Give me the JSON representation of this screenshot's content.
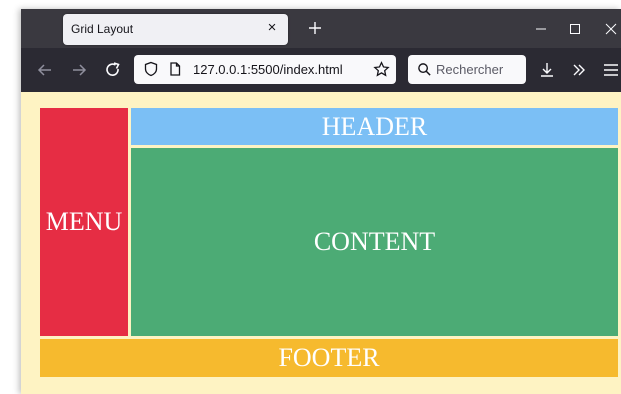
{
  "browser": {
    "tab": {
      "title": "Grid Layout",
      "close_glyph": "×"
    },
    "new_tab_icon": "plus-icon",
    "window_controls": [
      "minimize-icon",
      "maximize-icon",
      "close-icon"
    ],
    "nav": {
      "back_icon": "arrow-left-icon",
      "forward_icon": "arrow-right-icon",
      "reload_icon": "reload-icon",
      "url": "127.0.0.1:5500/index.html",
      "search_placeholder": "Rechercher",
      "right_icons": [
        "download-icon",
        "overflow-chevron-icon",
        "hamburger-menu-icon"
      ]
    }
  },
  "page": {
    "background": "#fef3c3",
    "regions": {
      "menu": {
        "label": "MENU",
        "color": "#e62d44"
      },
      "header": {
        "label": "HEADER",
        "color": "#7bbff5"
      },
      "content": {
        "label": "CONTENT",
        "color": "#4cab75"
      },
      "footer": {
        "label": "FOOTER",
        "color": "#f6ba2e"
      }
    }
  }
}
